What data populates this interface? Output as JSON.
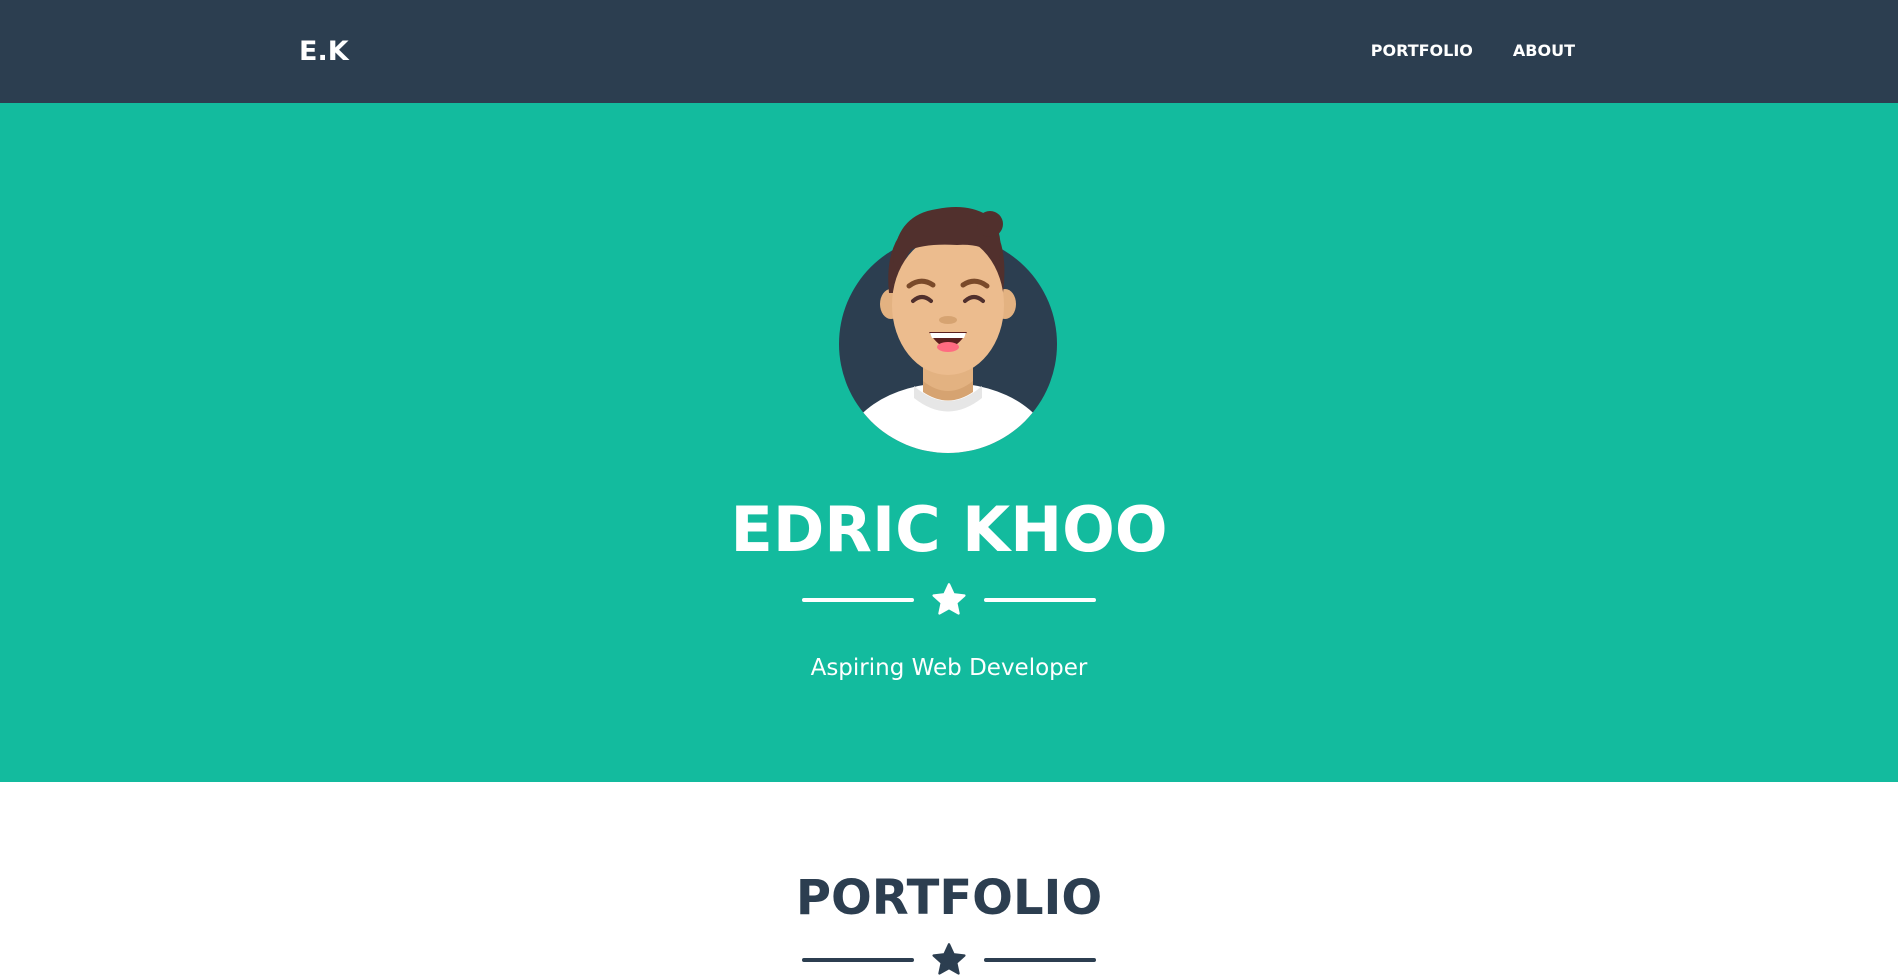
{
  "navbar": {
    "brand": "E.K",
    "links": [
      {
        "label": "PORTFOLIO"
      },
      {
        "label": "ABOUT"
      }
    ]
  },
  "hero": {
    "title": "EDRIC KHOO",
    "subtitle": "Aspiring Web Developer",
    "divider_icon": "star-icon",
    "avatar_icon": "avatar-illustration"
  },
  "portfolio": {
    "title": "PORTFOLIO",
    "divider_icon": "star-icon"
  },
  "colors": {
    "navbar_bg": "#2c3e50",
    "hero_bg": "#13bb9e",
    "text_light": "#ffffff",
    "text_dark": "#2c3e50"
  }
}
